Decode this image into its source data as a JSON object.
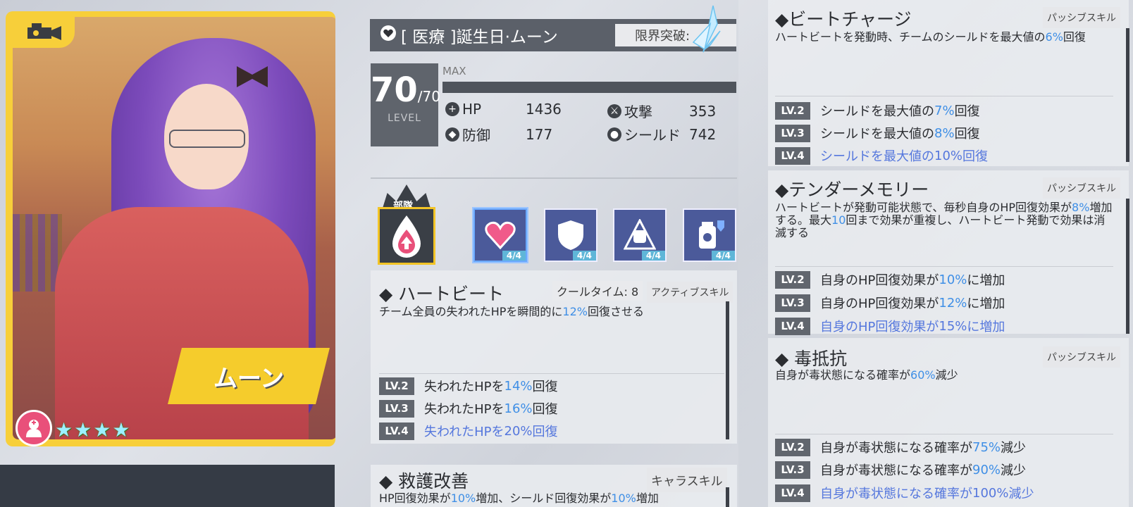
{
  "character": {
    "name_plate": "ムーン",
    "title": "[ 医療 ]誕生日·ムーン",
    "limit_break_label": "限界突破:",
    "level": "70",
    "level_max": "/70",
    "level_label": "LEVEL",
    "exp_label": "MAX",
    "stars": 4,
    "stats": {
      "hp_label": "HP",
      "hp": "1436",
      "atk_label": "攻撃",
      "atk": "353",
      "def_label": "防御",
      "def": "177",
      "shield_label": "シールド",
      "shield": "742"
    }
  },
  "squad": {
    "label": "部隊"
  },
  "skill_slots": [
    {
      "icon": "heart-icon",
      "count": "4/4"
    },
    {
      "icon": "shield-icon",
      "count": "4/4"
    },
    {
      "icon": "fist-icon",
      "count": "4/4"
    },
    {
      "icon": "poison-bottle-icon",
      "count": "4/4"
    }
  ],
  "active_skill": {
    "name": "◆ ハートビート",
    "cooldown": "クールタイム: 8",
    "type": "アクティブスキル",
    "desc_pre": "チーム全員の失われたHPを瞬間的に",
    "desc_hl": "12%",
    "desc_post": "回復させる",
    "levels": [
      {
        "lv": "LV.2",
        "pre": "失われたHPを",
        "hl": "14%",
        "post": "回復"
      },
      {
        "lv": "LV.3",
        "pre": "失われたHPを",
        "hl": "16%",
        "post": "回復"
      },
      {
        "lv": "LV.4",
        "pre": "失われたHPを",
        "hl": "20%",
        "post": "回復"
      }
    ]
  },
  "chara_skill": {
    "name": "◆ 救護改善",
    "type": "キャラスキル",
    "desc_a": "HP回復効果が",
    "desc_hl1": "10%",
    "desc_b": "増加、シールド回復効果が",
    "desc_hl2": "10%",
    "desc_c": "増加"
  },
  "passives": [
    {
      "name": "◆ビートチャージ",
      "type": "パッシブスキル",
      "desc_pre": "ハートビートを発動時、チームのシールドを最大値の",
      "desc_hl": "6%",
      "desc_post": "回復",
      "levels": [
        {
          "lv": "LV.2",
          "pre": "シールドを最大値の",
          "hl": "7%",
          "post": "回復"
        },
        {
          "lv": "LV.3",
          "pre": "シールドを最大値の",
          "hl": "8%",
          "post": "回復"
        },
        {
          "lv": "LV.4",
          "pre": "シールドを最大値の",
          "hl": "10%",
          "post": "回復"
        }
      ]
    },
    {
      "name": "◆テンダーメモリー",
      "type": "パッシブスキル",
      "desc_a": "ハートビートが発動可能状態で、毎秒自身のHP回復効果が",
      "desc_hl1": "8%",
      "desc_b": "増加する。最大",
      "desc_hl2": "10",
      "desc_c": "回まで効果が重複し、ハートビート発動で効果は消滅する",
      "levels": [
        {
          "lv": "LV.2",
          "pre": "自身のHP回復効果が",
          "hl": "10%",
          "post": "に増加"
        },
        {
          "lv": "LV.3",
          "pre": "自身のHP回復効果が",
          "hl": "12%",
          "post": "に増加"
        },
        {
          "lv": "LV.4",
          "pre": "自身のHP回復効果が",
          "hl": "15%",
          "post": "に増加"
        }
      ]
    },
    {
      "name": "◆ 毒抵抗",
      "type": "パッシブスキル",
      "desc_pre": "自身が毒状態になる確率が",
      "desc_hl": "60%",
      "desc_post": "減少",
      "levels": [
        {
          "lv": "LV.2",
          "pre": "自身が毒状態になる確率が",
          "hl": "75%",
          "post": "減少"
        },
        {
          "lv": "LV.3",
          "pre": "自身が毒状態になる確率が",
          "hl": "90%",
          "post": "減少"
        },
        {
          "lv": "LV.4",
          "pre": "自身が毒状態になる確率が",
          "hl": "100%",
          "post": "減少"
        }
      ]
    }
  ],
  "colors": {
    "accent": "#3f8fe6",
    "card": "#f7cf3a",
    "max_level": "#5577dd",
    "role_badge": "#e9507a"
  }
}
